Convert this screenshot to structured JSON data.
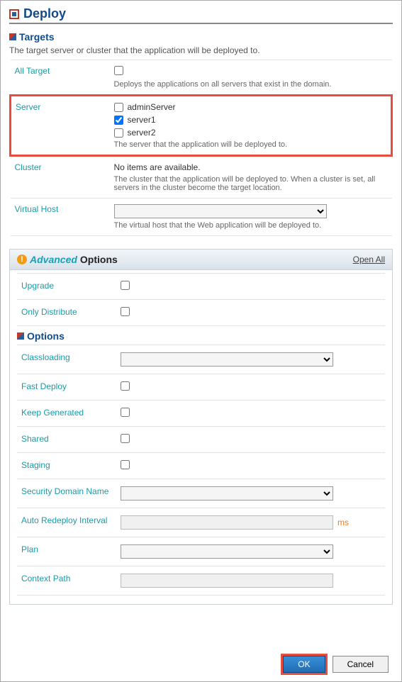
{
  "dialog": {
    "title": "Deploy"
  },
  "targets": {
    "heading": "Targets",
    "description": "The target server or cluster that the application will be deployed to.",
    "all": {
      "label": "All Target",
      "checked": false,
      "help": "Deploys the applications on all servers that exist in the domain."
    },
    "server": {
      "label": "Server",
      "options": [
        {
          "name": "adminServer",
          "checked": false
        },
        {
          "name": "server1",
          "checked": true
        },
        {
          "name": "server2",
          "checked": false
        }
      ],
      "help": "The server that the application will be deployed to."
    },
    "cluster": {
      "label": "Cluster",
      "empty": "No items are available.",
      "help": "The cluster that the application will be deployed to. When a cluster is set, all servers in the cluster become the target location."
    },
    "vhost": {
      "label": "Virtual Host",
      "selected": "",
      "help": "The virtual host that the Web application will be deployed to."
    }
  },
  "advanced": {
    "word": "Advanced",
    "opts": "Options",
    "open_all": "Open All",
    "upgrade": {
      "label": "Upgrade",
      "checked": false
    },
    "only_distribute": {
      "label": "Only Distribute",
      "checked": false
    },
    "options_heading": "Options",
    "classloading": {
      "label": "Classloading",
      "selected": ""
    },
    "fast_deploy": {
      "label": "Fast Deploy",
      "checked": false
    },
    "keep_generated": {
      "label": "Keep Generated",
      "checked": false
    },
    "shared": {
      "label": "Shared",
      "checked": false
    },
    "staging": {
      "label": "Staging",
      "checked": false
    },
    "security_domain": {
      "label": "Security Domain Name",
      "selected": ""
    },
    "auto_redeploy": {
      "label": "Auto Redeploy Interval",
      "value": "",
      "unit": "ms"
    },
    "plan": {
      "label": "Plan",
      "selected": ""
    },
    "context_path": {
      "label": "Context Path",
      "value": ""
    }
  },
  "buttons": {
    "ok": "OK",
    "cancel": "Cancel"
  }
}
